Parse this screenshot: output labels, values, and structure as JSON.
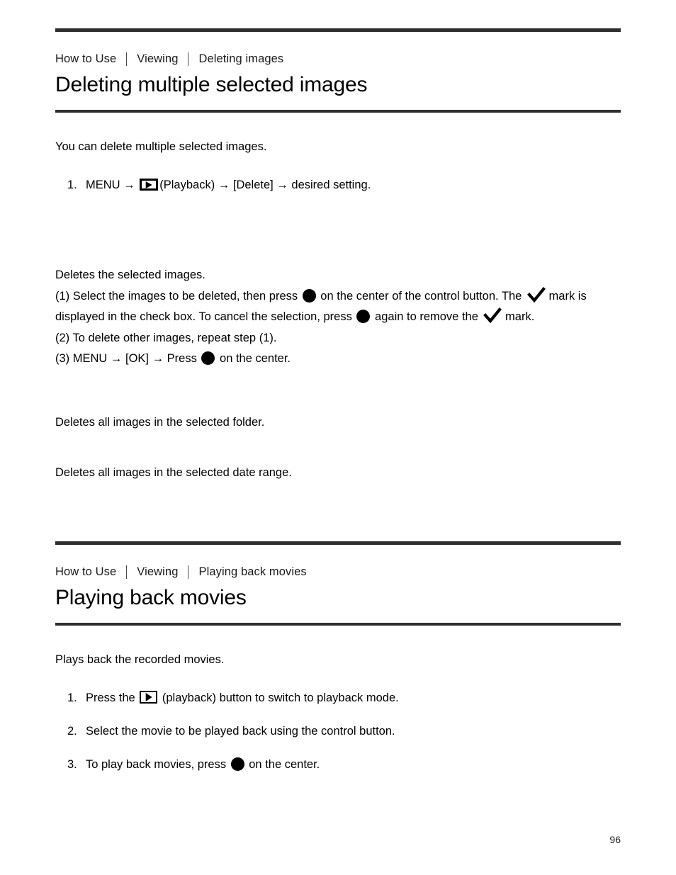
{
  "document": {
    "page_number": "96",
    "rule_color": "#2e2e2e",
    "text_color": "#000000"
  },
  "sections": [
    {
      "breadcrumb": [
        "How to Use",
        "Viewing",
        "Deleting images"
      ],
      "title": "Deleting multiple selected images",
      "intro": "You can delete multiple selected images.",
      "steps": [
        {
          "number": "1.",
          "before_icon": "MENU → ",
          "icon": "playback-icon",
          "after_icon": "(Playback) → [Delete] → desired setting."
        }
      ],
      "option_descriptions": [
        {
          "heading": "Deletes the selected images.",
          "lines": [
            "(1) Select the images to be deleted, then press ",
            " on the center of the control button. The ",
            " mark is displayed in the check box. To cancel the selection, press ",
            " again to remove the ",
            " mark.",
            "(2) To delete other images, repeat step (1).",
            "(3) MENU → [OK] → Press ",
            " on the center."
          ]
        },
        {
          "text": "Deletes all images in the selected folder."
        },
        {
          "text": "Deletes all images in the selected date range."
        }
      ]
    },
    {
      "breadcrumb": [
        "How to Use",
        "Viewing",
        "Playing back movies"
      ],
      "title": "Playing back movies",
      "intro": "Plays back the recorded movies.",
      "steps": [
        {
          "number": "1.",
          "before_icon": "Press the ",
          "icon": "playback-icon",
          "after_icon": " (playback) button to switch to playback mode."
        },
        {
          "number": "2.",
          "text": "Select the movie to be played back using the control button."
        },
        {
          "number": "3.",
          "before_icon": "To play back movies, press ",
          "icon": "center-button-icon",
          "after_icon": " on the center."
        }
      ]
    }
  ]
}
